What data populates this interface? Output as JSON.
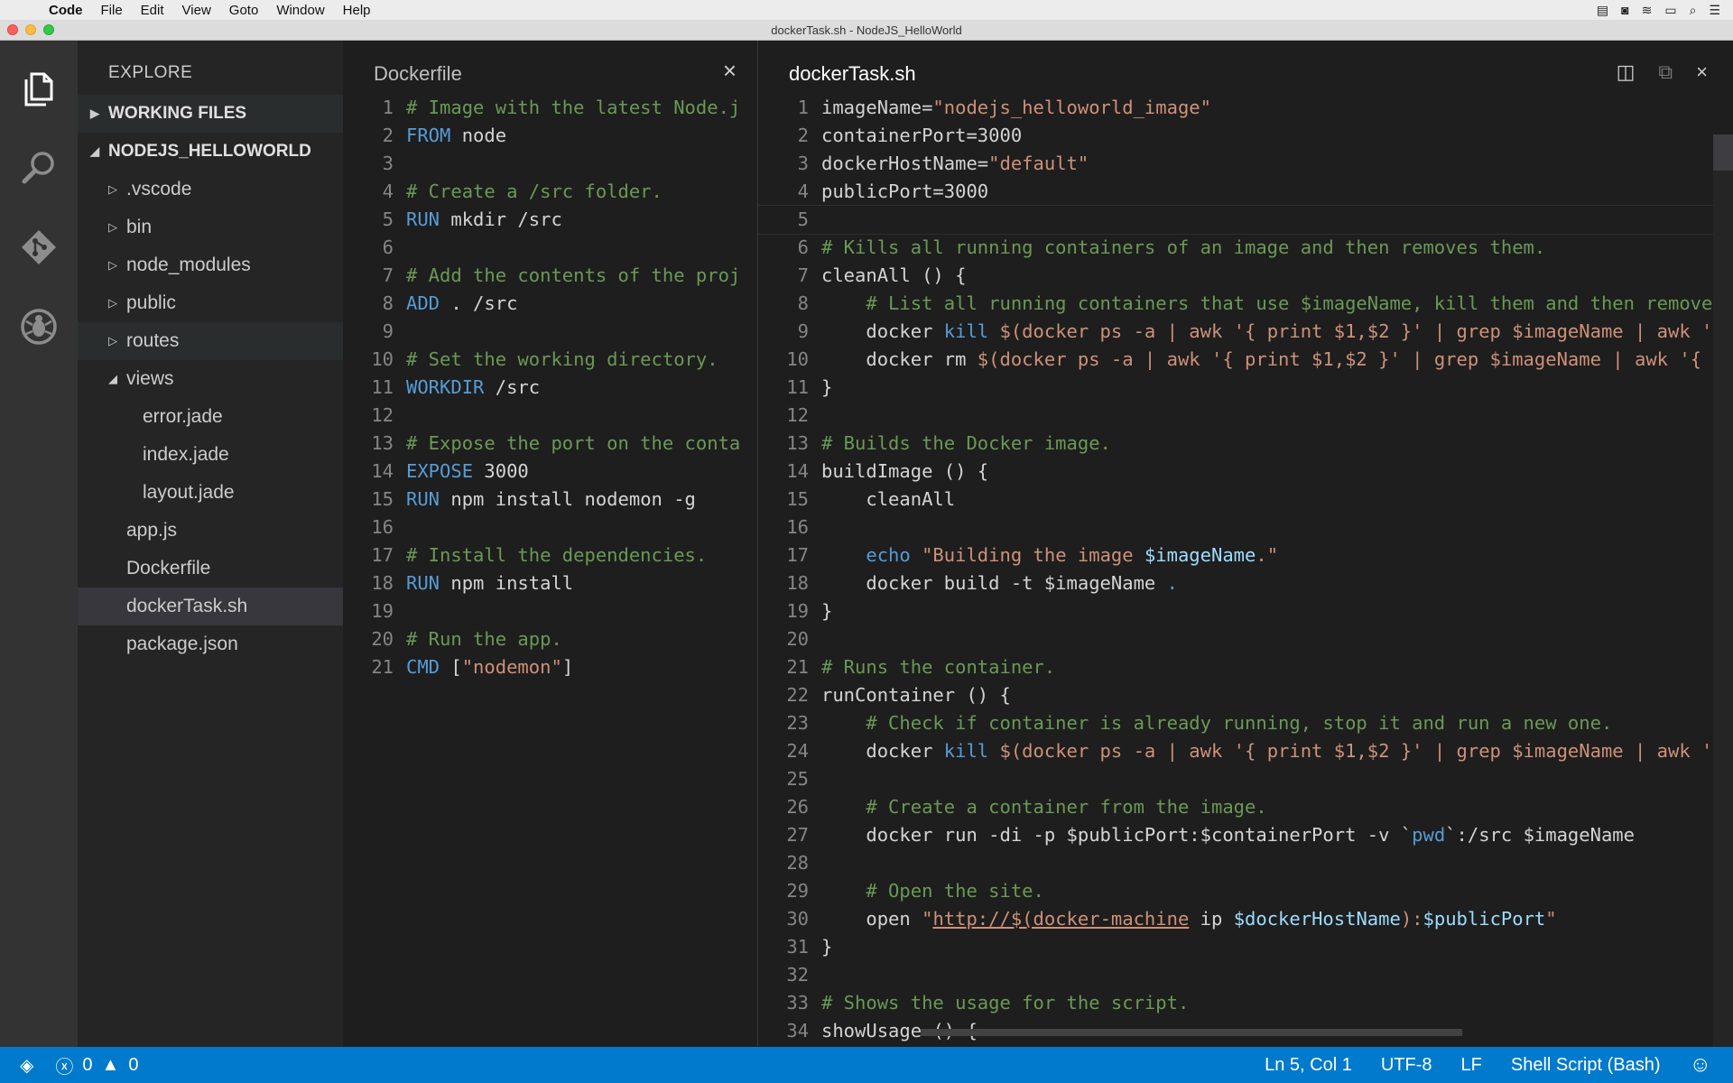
{
  "menubar": {
    "app_name": "Code",
    "items": [
      "File",
      "Edit",
      "View",
      "Goto",
      "Window",
      "Help"
    ],
    "right_icons": [
      "film-icon",
      "camera-icon",
      "wifi-icon",
      "battery-icon",
      "spotlight-icon",
      "list-icon"
    ]
  },
  "window": {
    "title": "dockerTask.sh - NodeJS_HelloWorld"
  },
  "activity": {
    "items": [
      "explorer-icon",
      "search-icon",
      "git-icon",
      "debug-icon"
    ]
  },
  "sidebar": {
    "header": "EXPLORE",
    "working_files": "WORKING FILES",
    "project": "NODEJS_HELLOWORLD",
    "tree": [
      {
        "label": ".vscode",
        "type": "folder",
        "depth": 1,
        "expanded": false
      },
      {
        "label": "bin",
        "type": "folder",
        "depth": 1,
        "expanded": false
      },
      {
        "label": "node_modules",
        "type": "folder",
        "depth": 1,
        "expanded": false
      },
      {
        "label": "public",
        "type": "folder",
        "depth": 1,
        "expanded": false
      },
      {
        "label": "routes",
        "type": "folder",
        "depth": 1,
        "expanded": false,
        "hover": true
      },
      {
        "label": "views",
        "type": "folder",
        "depth": 1,
        "expanded": true
      },
      {
        "label": "error.jade",
        "type": "file",
        "depth": 2
      },
      {
        "label": "index.jade",
        "type": "file",
        "depth": 2
      },
      {
        "label": "layout.jade",
        "type": "file",
        "depth": 2
      },
      {
        "label": "app.js",
        "type": "file",
        "depth": 1
      },
      {
        "label": "Dockerfile",
        "type": "file",
        "depth": 1
      },
      {
        "label": "dockerTask.sh",
        "type": "file",
        "depth": 1,
        "selected": true
      },
      {
        "label": "package.json",
        "type": "file",
        "depth": 1
      }
    ]
  },
  "editor_left": {
    "filename": "Dockerfile",
    "close_glyph": "×",
    "lines": [
      [
        [
          "c-com",
          "# Image with the latest Node.j"
        ]
      ],
      [
        [
          "c-kw",
          "FROM"
        ],
        [
          "c-cmd",
          " node"
        ]
      ],
      [],
      [
        [
          "c-com",
          "# Create a /src folder."
        ]
      ],
      [
        [
          "c-kw",
          "RUN"
        ],
        [
          "c-cmd",
          " mkdir /src"
        ]
      ],
      [],
      [
        [
          "c-com",
          "# Add the contents of the proj"
        ]
      ],
      [
        [
          "c-kw",
          "ADD"
        ],
        [
          "c-cmd",
          " . /src"
        ]
      ],
      [],
      [
        [
          "c-com",
          "# Set the working directory."
        ]
      ],
      [
        [
          "c-kw",
          "WORKDIR"
        ],
        [
          "c-cmd",
          " /src"
        ]
      ],
      [],
      [
        [
          "c-com",
          "# Expose the port on the conta"
        ]
      ],
      [
        [
          "c-kw",
          "EXPOSE"
        ],
        [
          "c-cmd",
          " 3000"
        ]
      ],
      [
        [
          "c-kw",
          "RUN"
        ],
        [
          "c-cmd",
          " npm install nodemon -g"
        ]
      ],
      [],
      [
        [
          "c-com",
          "# Install the dependencies."
        ]
      ],
      [
        [
          "c-kw",
          "RUN"
        ],
        [
          "c-cmd",
          " npm install"
        ]
      ],
      [],
      [
        [
          "c-com",
          "# Run the app."
        ]
      ],
      [
        [
          "c-kw",
          "CMD"
        ],
        [
          "c-cmd",
          " ["
        ],
        [
          "c-str",
          "\"nodemon\""
        ],
        [
          "c-cmd",
          "]"
        ]
      ]
    ]
  },
  "editor_right": {
    "filename": "dockerTask.sh",
    "close_glyph": "×",
    "toolbar_icons": [
      "split-editor-icon",
      "open-changes-icon"
    ],
    "lines": [
      [
        [
          "c-cmd",
          "imageName="
        ],
        [
          "c-str",
          "\"nodejs_helloworld_image\""
        ]
      ],
      [
        [
          "c-cmd",
          "containerPort=3000"
        ]
      ],
      [
        [
          "c-cmd",
          "dockerHostName="
        ],
        [
          "c-str",
          "\"default\""
        ]
      ],
      [
        [
          "c-cmd",
          "publicPort=3000"
        ]
      ],
      [],
      [
        [
          "c-com",
          "# Kills all running containers of an image and then removes them."
        ]
      ],
      [
        [
          "c-cmd",
          "cleanAll () {"
        ]
      ],
      [
        [
          "c-com",
          "    # List all running containers that use $imageName, kill them and then remove"
        ]
      ],
      [
        [
          "c-cmd",
          "    docker "
        ],
        [
          "c-kw",
          "kill"
        ],
        [
          "c-str",
          " $(docker ps -a | awk '{ print $1,$2 }' | grep $imageName | awk '"
        ]
      ],
      [
        [
          "c-cmd",
          "    docker rm "
        ],
        [
          "c-str",
          "$(docker ps -a | awk '{ print $1,$2 }' | grep $imageName | awk '{"
        ]
      ],
      [
        [
          "c-cmd",
          "}"
        ]
      ],
      [],
      [
        [
          "c-com",
          "# Builds the Docker image."
        ]
      ],
      [
        [
          "c-cmd",
          "buildImage () {"
        ]
      ],
      [
        [
          "c-cmd",
          "    cleanAll"
        ]
      ],
      [],
      [
        [
          "c-cmd",
          "    "
        ],
        [
          "c-kw",
          "echo"
        ],
        [
          "c-str",
          " \"Building the image "
        ],
        [
          "c-var",
          "$imageName"
        ],
        [
          "c-str",
          ".\""
        ]
      ],
      [
        [
          "c-cmd",
          "    docker build -t $imageName "
        ],
        [
          "c-kw",
          "."
        ]
      ],
      [
        [
          "c-cmd",
          "}"
        ]
      ],
      [],
      [
        [
          "c-com",
          "# Runs the container."
        ]
      ],
      [
        [
          "c-cmd",
          "runContainer () {"
        ]
      ],
      [
        [
          "c-com",
          "    # Check if container is already running, stop it and run a new one."
        ]
      ],
      [
        [
          "c-cmd",
          "    docker "
        ],
        [
          "c-kw",
          "kill"
        ],
        [
          "c-str",
          " $(docker ps -a | awk '{ print $1,$2 }' | grep $imageName | awk '"
        ]
      ],
      [],
      [
        [
          "c-com",
          "    # Create a container from the image."
        ]
      ],
      [
        [
          "c-cmd",
          "    docker run -di -p $publicPort:$containerPort -v `"
        ],
        [
          "c-kw",
          "pwd"
        ],
        [
          "c-cmd",
          "`:/src $imageName"
        ]
      ],
      [],
      [
        [
          "c-com",
          "    # Open the site."
        ]
      ],
      [
        [
          "c-cmd",
          "    open "
        ],
        [
          "c-str",
          "\""
        ],
        [
          "c-url",
          "http://$(docker-machine"
        ],
        [
          "c-cmd",
          " ip "
        ],
        [
          "c-var",
          "$dockerHostName"
        ],
        [
          "c-str",
          "):"
        ],
        [
          "c-var",
          "$publicPort"
        ],
        [
          "c-str",
          "\""
        ]
      ],
      [
        [
          "c-cmd",
          "}"
        ]
      ],
      [],
      [
        [
          "c-com",
          "# Shows the usage for the script."
        ]
      ],
      [
        [
          "c-cmd",
          "showUsage () {"
        ]
      ]
    ]
  },
  "statusbar": {
    "errors": "0",
    "warnings": "0",
    "position": "Ln 5, Col 1",
    "encoding": "UTF-8",
    "eol": "LF",
    "language": "Shell Script (Bash)"
  },
  "colors": {
    "accent": "#007acc",
    "sidebar": "#252526",
    "editor": "#1e1e1e"
  }
}
